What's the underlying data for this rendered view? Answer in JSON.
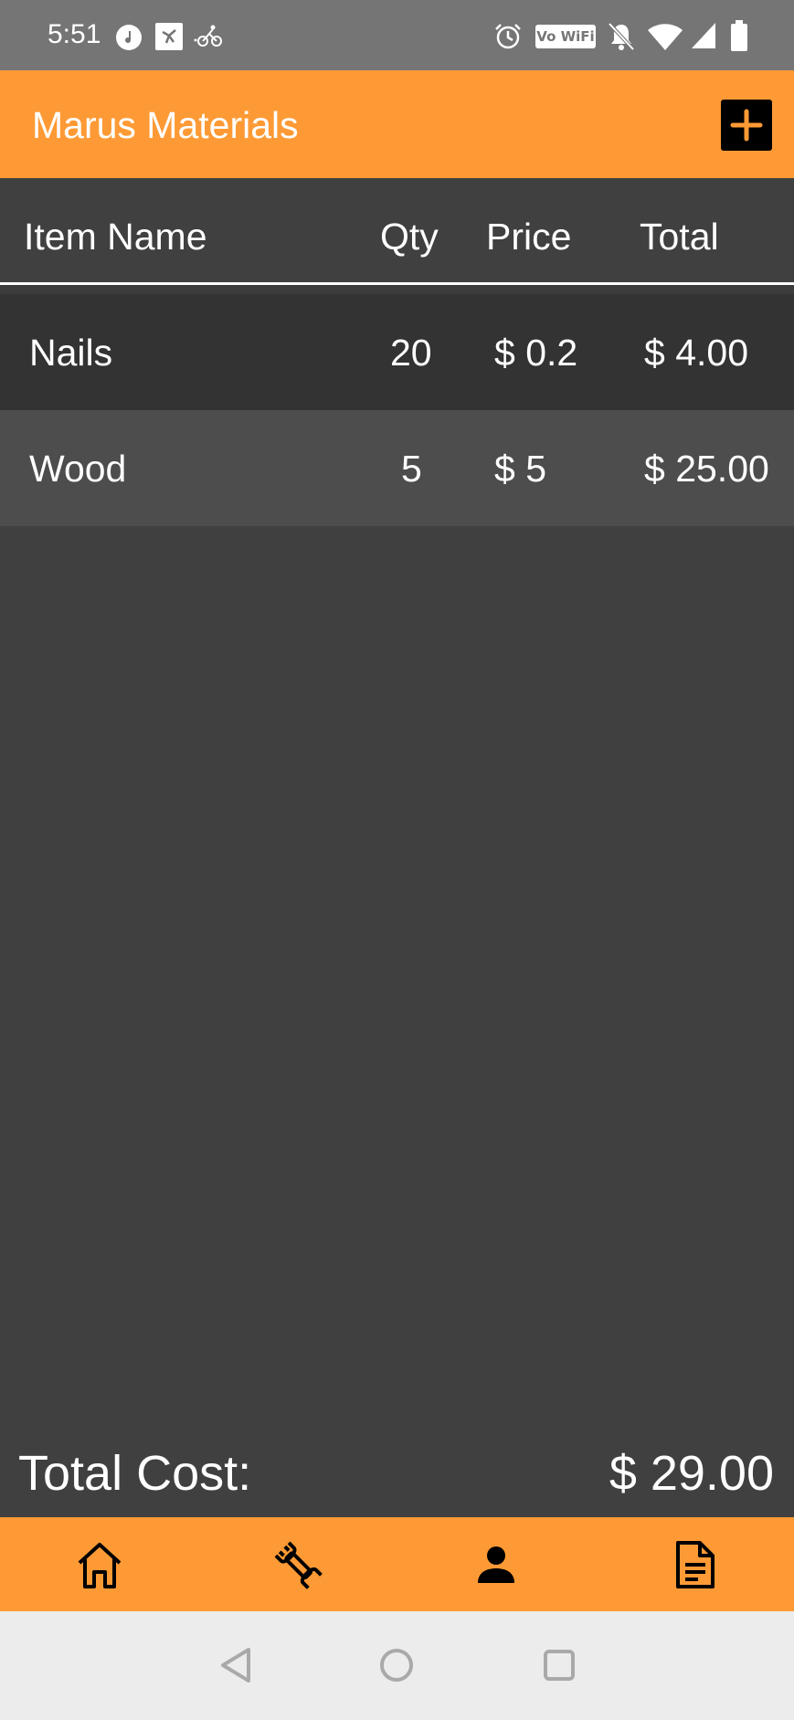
{
  "status_bar": {
    "time": "5:51",
    "wifi_badge": "Vo WiFi",
    "icons": [
      "music-app-icon",
      "fitness-app-icon",
      "cycling-app-icon",
      "alarm-icon",
      "vowifi-icon",
      "notifications-off-icon",
      "wifi-icon",
      "signal-icon",
      "battery-icon"
    ]
  },
  "app_bar": {
    "title": "Marus Materials",
    "add_icon": "plus-icon"
  },
  "table": {
    "headers": {
      "item_name": "Item Name",
      "qty": "Qty",
      "price": "Price",
      "total": "Total"
    },
    "rows": [
      {
        "name": "Nails",
        "qty": "20",
        "price": "$ 0.2",
        "total": "$ 4.00"
      },
      {
        "name": "Wood",
        "qty": "5",
        "price": "$ 5",
        "total": "$ 25.00"
      }
    ]
  },
  "summary": {
    "label": "Total Cost:",
    "value": "$ 29.00"
  },
  "bottom_nav": {
    "items": [
      "home-icon",
      "wrench-icon",
      "person-icon",
      "document-icon"
    ]
  },
  "system_nav": {
    "items": [
      "back-icon",
      "home-circle-icon",
      "recents-icon"
    ]
  },
  "colors": {
    "accent": "#fe9a35",
    "background": "#404040",
    "row_dark": "#333333",
    "row_light": "#4d4d4d",
    "status_bar": "#757575"
  }
}
